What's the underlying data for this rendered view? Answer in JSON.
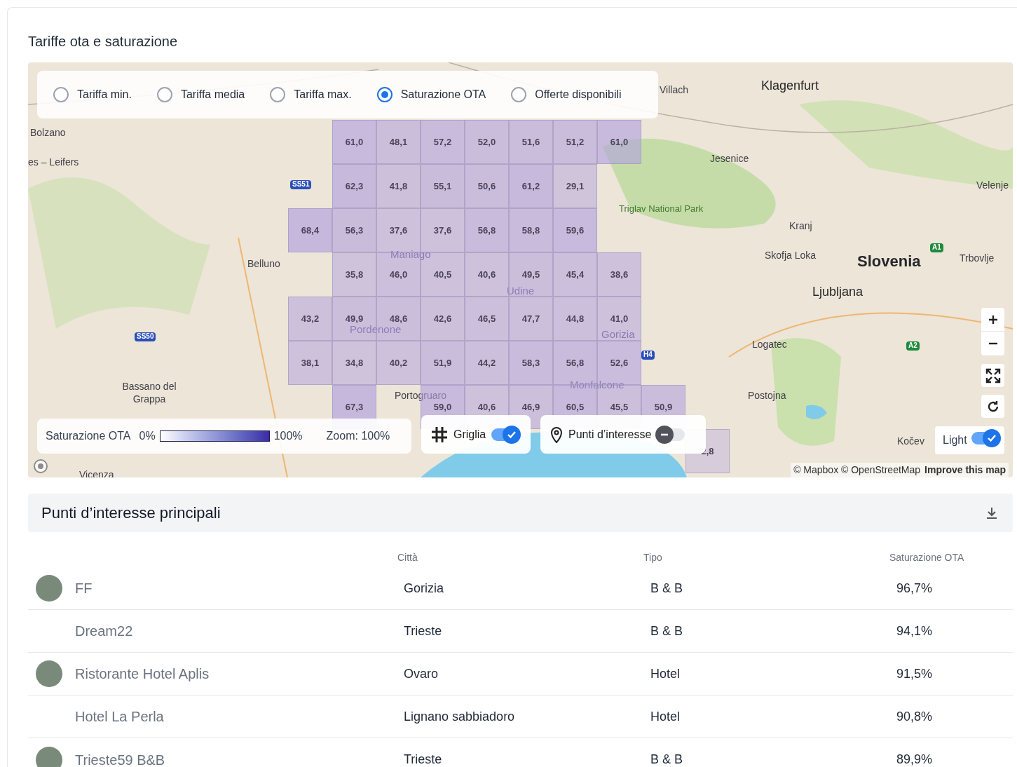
{
  "title": "Tariffe ota e saturazione",
  "map": {
    "modes": [
      {
        "label": "Tariffa min.",
        "selected": false
      },
      {
        "label": "Tariffa media",
        "selected": false
      },
      {
        "label": "Tariffa max.",
        "selected": false
      },
      {
        "label": "Saturazione OTA",
        "selected": true
      },
      {
        "label": "Offerte disponibili",
        "selected": false
      }
    ],
    "places": [
      {
        "kind": "city",
        "label": "Bolzano"
      },
      {
        "kind": "city",
        "label": "es – Leifers"
      },
      {
        "kind": "city",
        "label": "Belluno"
      },
      {
        "kind": "city",
        "label": "Bassano del Grappa"
      },
      {
        "kind": "city",
        "label": "Villach"
      },
      {
        "kind": "major",
        "label": "Klagenfurt"
      },
      {
        "kind": "city",
        "label": "Jesenice"
      },
      {
        "kind": "park",
        "label": "Triglav National Park"
      },
      {
        "kind": "city",
        "label": "Velenje"
      },
      {
        "kind": "city",
        "label": "Kranj"
      },
      {
        "kind": "city",
        "label": "Skofja Loka"
      },
      {
        "kind": "country",
        "label": "Slovenia"
      },
      {
        "kind": "city",
        "label": "Trbovlje"
      },
      {
        "kind": "major",
        "label": "Ljubljana"
      },
      {
        "kind": "city",
        "label": "Logatec"
      },
      {
        "kind": "city",
        "label": "Postojna"
      },
      {
        "kind": "city",
        "label": "Kočev"
      },
      {
        "kind": "faded",
        "label": "Udine"
      },
      {
        "kind": "faded",
        "label": "Pordenone"
      },
      {
        "kind": "faded",
        "label": "Gorizia"
      },
      {
        "kind": "faded",
        "label": "Monfalcone"
      },
      {
        "kind": "city",
        "label": "Portogruaro"
      },
      {
        "kind": "city",
        "label": "Vicenza"
      },
      {
        "kind": "faded",
        "label": "Maniago"
      },
      {
        "kind": "shield",
        "label": "SS51"
      },
      {
        "kind": "shield",
        "label": "SS50"
      },
      {
        "kind": "shield",
        "label": "H4"
      },
      {
        "kind": "motorway",
        "label": "A1"
      },
      {
        "kind": "motorway",
        "label": "A2"
      }
    ],
    "grid": [
      [
        {
          "kind": "gap"
        },
        {
          "kind": "cell",
          "value": "61,0"
        },
        {
          "kind": "cell",
          "value": "48,1"
        },
        {
          "kind": "cell",
          "value": "57,2"
        },
        {
          "kind": "cell",
          "value": "52,0"
        },
        {
          "kind": "cell",
          "value": "51,6"
        },
        {
          "kind": "cell",
          "value": "51,2"
        },
        {
          "kind": "cell",
          "value": "61,0"
        }
      ],
      [
        {
          "kind": "gap"
        },
        {
          "kind": "cell",
          "value": "62,3"
        },
        {
          "kind": "cell",
          "value": "41,8"
        },
        {
          "kind": "cell",
          "value": "55,1"
        },
        {
          "kind": "cell",
          "value": "50,6"
        },
        {
          "kind": "cell",
          "value": "61,2"
        },
        {
          "kind": "cell",
          "value": "29,1"
        }
      ],
      [
        {
          "kind": "cell",
          "value": "68,4"
        },
        {
          "kind": "cell",
          "value": "56,3"
        },
        {
          "kind": "cell",
          "value": "37,6"
        },
        {
          "kind": "cell",
          "value": "37,6"
        },
        {
          "kind": "cell",
          "value": "56,8"
        },
        {
          "kind": "cell",
          "value": "58,8"
        },
        {
          "kind": "cell",
          "value": "59,6"
        }
      ],
      [
        {
          "kind": "gap"
        },
        {
          "kind": "cell",
          "value": "35,8"
        },
        {
          "kind": "cell",
          "value": "46,0"
        },
        {
          "kind": "cell",
          "value": "40,5"
        },
        {
          "kind": "cell",
          "value": "40,6"
        },
        {
          "kind": "cell",
          "value": "49,5"
        },
        {
          "kind": "cell",
          "value": "45,4"
        },
        {
          "kind": "cell",
          "value": "38,6"
        }
      ],
      [
        {
          "kind": "cell",
          "value": "43,2"
        },
        {
          "kind": "cell",
          "value": "49,9"
        },
        {
          "kind": "cell",
          "value": "48,6"
        },
        {
          "kind": "cell",
          "value": "42,6"
        },
        {
          "kind": "cell",
          "value": "46,5"
        },
        {
          "kind": "cell",
          "value": "47,7"
        },
        {
          "kind": "cell",
          "value": "44,8"
        },
        {
          "kind": "cell",
          "value": "41,0"
        }
      ],
      [
        {
          "kind": "cell",
          "value": "38,1"
        },
        {
          "kind": "cell",
          "value": "34,8"
        },
        {
          "kind": "cell",
          "value": "40,2"
        },
        {
          "kind": "cell",
          "value": "51,9"
        },
        {
          "kind": "cell",
          "value": "44,2"
        },
        {
          "kind": "cell",
          "value": "58,3"
        },
        {
          "kind": "cell",
          "value": "56,8"
        },
        {
          "kind": "cell",
          "value": "52,6"
        }
      ],
      [
        {
          "kind": "gap"
        },
        {
          "kind": "cell",
          "value": "67,3"
        },
        {
          "kind": "gap"
        },
        {
          "kind": "cell",
          "value": "59,0"
        },
        {
          "kind": "cell",
          "value": "40,6"
        },
        {
          "kind": "cell",
          "value": "46,9"
        },
        {
          "kind": "cell",
          "value": "60,5"
        },
        {
          "kind": "cell",
          "value": "45,5"
        },
        {
          "kind": "cell",
          "value": "50,9"
        }
      ],
      [
        {
          "kind": "gap"
        },
        {
          "kind": "gap"
        },
        {
          "kind": "gap"
        },
        {
          "kind": "gap"
        },
        {
          "kind": "gap"
        },
        {
          "kind": "gap"
        },
        {
          "kind": "gap"
        },
        {
          "kind": "gap"
        },
        {
          "kind": "gap"
        },
        {
          "kind": "cell",
          "value": "2,8"
        }
      ]
    ],
    "legend": {
      "label": "Saturazione OTA",
      "min": "0%",
      "max": "100%",
      "zoom": "Zoom: 100%"
    },
    "toggles": [
      {
        "kind": "grid",
        "label": "Griglia",
        "on": true
      },
      {
        "kind": "pin",
        "label": "Punti d’interesse",
        "on": false
      }
    ],
    "style_toggle": {
      "label": "Light",
      "on": true
    },
    "attribution": {
      "text": "© Mapbox © OpenStreetMap",
      "link": "Improve this map"
    }
  },
  "poi": {
    "title": "Punti d’interesse principali",
    "columns": [
      "Città",
      "Tipo",
      "Saturazione OTA"
    ],
    "rows": [
      {
        "photo": true,
        "name": "FF",
        "city": "Gorizia",
        "type": "B & B",
        "saturation": "96,7%"
      },
      {
        "photo": false,
        "name": "Dream22",
        "city": "Trieste",
        "type": "B & B",
        "saturation": "94,1%"
      },
      {
        "photo": true,
        "name": "Ristorante Hotel Aplis",
        "city": "Ovaro",
        "type": "Hotel",
        "saturation": "91,5%"
      },
      {
        "photo": false,
        "name": "Hotel La Perla",
        "city": "Lignano sabbiadoro",
        "type": "Hotel",
        "saturation": "90,8%"
      },
      {
        "photo": true,
        "name": "Trieste59 B&B",
        "city": "Trieste",
        "type": "B & B",
        "saturation": "89,9%"
      }
    ]
  }
}
